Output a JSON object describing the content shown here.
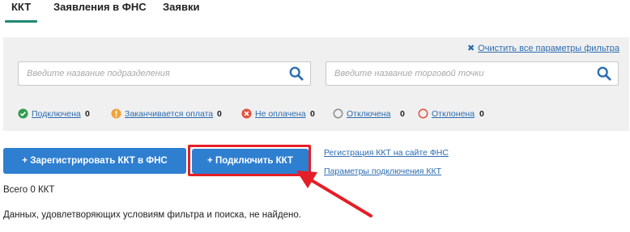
{
  "tabs": [
    {
      "label": "ККТ",
      "active": true
    },
    {
      "label": "Заявления в ФНС",
      "active": false
    },
    {
      "label": "Заявки",
      "active": false
    }
  ],
  "filter": {
    "clear_label": "Очистить все параметры фильтра",
    "search_division_placeholder": "Введите название подразделения",
    "search_point_placeholder": "Введите название торговой точки"
  },
  "statuses": [
    {
      "label": "Подключена",
      "count": "0",
      "icon": "check-circle-icon",
      "color": "#2e9b4e"
    },
    {
      "label": "Заканчивается оплата",
      "count": "0",
      "icon": "warning-circle-icon",
      "color": "#f0a23a"
    },
    {
      "label": "Не оплачена",
      "count": "0",
      "icon": "x-circle-icon",
      "color": "#e0533e"
    },
    {
      "label": "Отключена",
      "count": "0",
      "icon": "grey-circle-icon",
      "color": "#8c8c8c"
    },
    {
      "label": "Отклонена",
      "count": "0",
      "icon": "red-circle-icon",
      "color": "#e0533e"
    }
  ],
  "actions": {
    "register_label": "+ Зарегистрировать ККТ в ФНС",
    "connect_label": "+ Подключить ККТ",
    "link_registration": "Регистрация ККТ на сайте ФНС",
    "link_params": "Параметры подключения ККТ"
  },
  "results": {
    "total_label": "Всего 0 ККТ",
    "empty_message": "Данных, удовлетворяющих условиям фильтра и поиска, не найдено."
  },
  "colors": {
    "accent": "#1e8a72",
    "button": "#2f7fd1",
    "link": "#2b6cb0",
    "highlight": "#e41e26"
  }
}
